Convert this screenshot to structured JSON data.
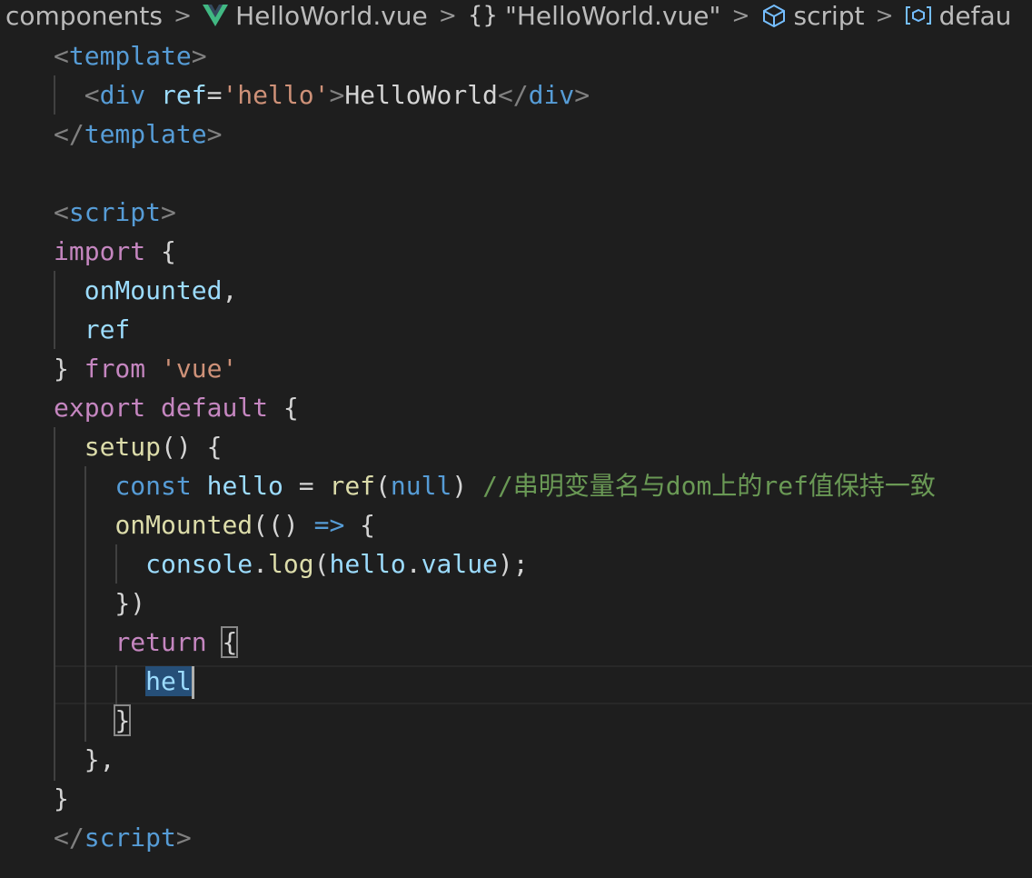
{
  "breadcrumb": {
    "items": [
      {
        "label": "components",
        "icon": "none"
      },
      {
        "label": "HelloWorld.vue",
        "icon": "vue-logo-icon"
      },
      {
        "label": "\"HelloWorld.vue\"",
        "icon": "braces-icon"
      },
      {
        "label": "script",
        "icon": "cube-icon"
      },
      {
        "label": "defau",
        "icon": "variable-icon"
      }
    ],
    "separator": ">"
  },
  "editor": {
    "lines": [
      [
        [
          "t-punc",
          "<"
        ],
        [
          "t-tag",
          "template"
        ],
        [
          "t-punc",
          ">"
        ]
      ],
      [
        [
          "t-text",
          "  "
        ],
        [
          "t-punc",
          "<"
        ],
        [
          "t-tag",
          "div"
        ],
        [
          "t-text",
          " "
        ],
        [
          "t-attr",
          "ref"
        ],
        [
          "t-text",
          "="
        ],
        [
          "t-str",
          "'hello'"
        ],
        [
          "t-punc",
          ">"
        ],
        [
          "t-text",
          "HelloWorld"
        ],
        [
          "t-punc",
          "</"
        ],
        [
          "t-tag",
          "div"
        ],
        [
          "t-punc",
          ">"
        ]
      ],
      [
        [
          "t-punc",
          "</"
        ],
        [
          "t-tag",
          "template"
        ],
        [
          "t-punc",
          ">"
        ]
      ],
      [],
      [
        [
          "t-punc",
          "<"
        ],
        [
          "t-tag",
          "script"
        ],
        [
          "t-punc",
          ">"
        ]
      ],
      [
        [
          "t-kw",
          "import"
        ],
        [
          "t-text",
          " {"
        ]
      ],
      [
        [
          "t-text",
          "  "
        ],
        [
          "t-var",
          "onMounted"
        ],
        [
          "t-text",
          ","
        ]
      ],
      [
        [
          "t-text",
          "  "
        ],
        [
          "t-var",
          "ref"
        ]
      ],
      [
        [
          "t-text",
          "} "
        ],
        [
          "t-kw",
          "from"
        ],
        [
          "t-text",
          " "
        ],
        [
          "t-str",
          "'vue'"
        ]
      ],
      [
        [
          "t-kw",
          "export"
        ],
        [
          "t-text",
          " "
        ],
        [
          "t-kw",
          "default"
        ],
        [
          "t-text",
          " {"
        ]
      ],
      [
        [
          "t-text",
          "  "
        ],
        [
          "t-fn",
          "setup"
        ],
        [
          "t-text",
          "() {"
        ]
      ],
      [
        [
          "t-text",
          "    "
        ],
        [
          "t-blue",
          "const"
        ],
        [
          "t-text",
          " "
        ],
        [
          "t-var",
          "hello"
        ],
        [
          "t-text",
          " = "
        ],
        [
          "t-fn",
          "ref"
        ],
        [
          "t-text",
          "("
        ],
        [
          "t-blue",
          "null"
        ],
        [
          "t-text",
          ") "
        ],
        [
          "t-com",
          "//串明变量名与dom上的ref值保持一致"
        ]
      ],
      [
        [
          "t-text",
          "    "
        ],
        [
          "t-fn",
          "onMounted"
        ],
        [
          "t-text",
          "(() "
        ],
        [
          "t-blue",
          "=>"
        ],
        [
          "t-text",
          " {"
        ]
      ],
      [
        [
          "t-text",
          "      "
        ],
        [
          "t-var",
          "console"
        ],
        [
          "t-text",
          "."
        ],
        [
          "t-fn",
          "log"
        ],
        [
          "t-text",
          "("
        ],
        [
          "t-var",
          "hello"
        ],
        [
          "t-text",
          "."
        ],
        [
          "t-var",
          "value"
        ],
        [
          "t-text",
          ");"
        ]
      ],
      [
        [
          "t-text",
          "    })"
        ]
      ],
      [
        [
          "t-text",
          "    "
        ],
        [
          "t-kw",
          "return"
        ],
        [
          "t-text",
          " "
        ],
        [
          "bracket-match",
          "{"
        ]
      ],
      [
        [
          "t-text",
          "      "
        ],
        [
          "sel",
          "hel"
        ],
        [
          "caret",
          ""
        ]
      ],
      [
        [
          "t-text",
          "    "
        ],
        [
          "bracket-match",
          "}"
        ]
      ],
      [
        [
          "t-text",
          "  },"
        ]
      ],
      [
        [
          "t-text",
          "}"
        ]
      ],
      [
        [
          "t-punc",
          "</"
        ],
        [
          "t-tag",
          "script"
        ],
        [
          "t-punc",
          ">"
        ]
      ]
    ]
  },
  "colors": {
    "background": "#1e1e1e",
    "tag": "#569cd6",
    "string": "#ce9178",
    "keyword": "#c586c0",
    "variable": "#9cdcfe",
    "function": "#dcdcaa",
    "comment": "#6a9955",
    "selection": "#264f78",
    "vue": "#41b883"
  }
}
